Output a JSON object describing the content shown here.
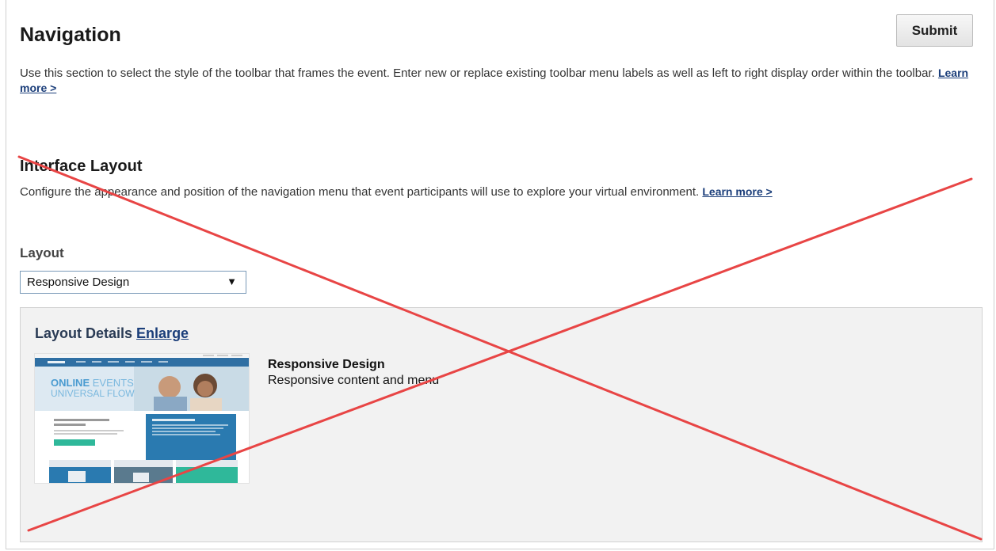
{
  "header": {
    "title": "Navigation",
    "submit_label": "Submit",
    "description": "Use this section to select the style of the toolbar that frames the event. Enter new or replace existing toolbar menu labels as well as left to right display order within the toolbar.",
    "learn_more": "Learn more >"
  },
  "interface_layout": {
    "title": "Interface Layout",
    "description": "Configure the appearance and position of the navigation menu that event participants will use to explore your virtual environment.",
    "learn_more": "Learn more >",
    "layout_label": "Layout",
    "layout_selected": "Responsive Design",
    "select_arrow": "▼"
  },
  "layout_details": {
    "title": "Layout Details",
    "enlarge": "Enlarge",
    "name": "Responsive Design",
    "description": "Responsive content and menu",
    "thumbnail": {
      "hero_line1_a": "ONLINE",
      "hero_line1_b": " EVENTS",
      "hero_line2": "UNIVERSAL FLOW"
    }
  },
  "colors": {
    "overlay_x": "#e84545",
    "link": "#1b3e7a",
    "panel_bg": "#f2f2f2"
  }
}
